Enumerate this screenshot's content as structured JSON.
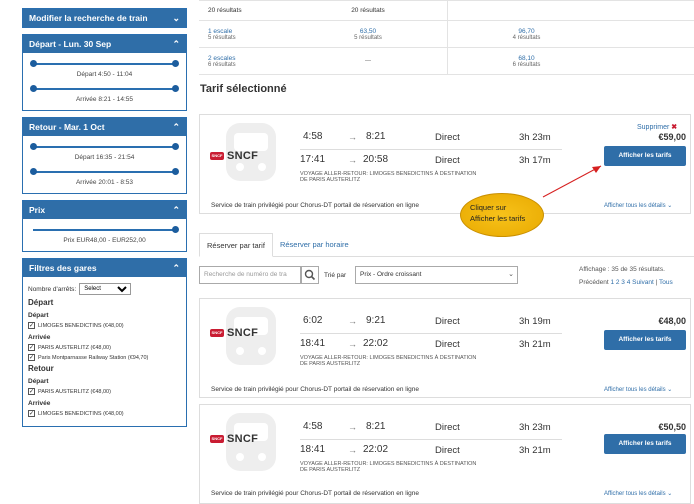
{
  "sidebar": {
    "modify_label": "Modifier la recherche de train",
    "depart_panel": {
      "title": "Départ - Lun. 30 Sep",
      "depart_range": "Départ   4:50 - 11:04",
      "arrivee_range": "Arrivée   8:21 - 14:55"
    },
    "retour_panel": {
      "title": "Retour - Mar. 1 Oct",
      "depart_range": "Départ   16:35 - 21:54",
      "arrivee_range": "Arrivée   20:01 - 8:53"
    },
    "prix_panel": {
      "title": "Prix",
      "range": "Prix   EUR48,00 - EUR252,00"
    },
    "gares_panel": {
      "title": "Filtres des gares",
      "nombre_label": "Nombre d'arrêts:",
      "nombre_value": "Select",
      "depart_heading": "Départ",
      "depart_sub": "Départ",
      "depart_station": "LIMOGES BENEDICTINS (€48,00)",
      "arrivee_sub": "Arrivée",
      "arrivee_station1": "PARIS AUSTERLITZ (€48,00)",
      "arrivee_station2": "Paris Montparnasse Railway Station (€94,70)",
      "retour_heading": "Retour",
      "retour_depart_sub": "Départ",
      "retour_depart_station": "PARIS AUSTERLITZ (€48,00)",
      "retour_arrivee_sub": "Arrivée",
      "retour_arrivee_station": "LIMOGES BENEDICTINS (€48,00)"
    }
  },
  "summary_table": {
    "rows": [
      {
        "label": "20 résultats",
        "col2": "20 résultats",
        "col3_main": "",
        "col3_sub": ""
      },
      {
        "label": "1 escale",
        "label_sub": "5 résultats",
        "col2": "63,50",
        "col2_sub": "5 résultats",
        "col3_main": "96,70",
        "col3_sub": "4 résultats"
      },
      {
        "label": "2 escales",
        "label_sub": "6 résultats",
        "col2": "—",
        "col2_sub": "",
        "col3_main": "68,10",
        "col3_sub": "6 résultats"
      }
    ]
  },
  "selected": {
    "heading": "Tarif sélectionné",
    "remove_label": "Supprimer",
    "remove_x": "✖",
    "price": "€59,00",
    "button": "Afficher les tarifs",
    "leg1": {
      "dep": "4:58",
      "arr": "8:21",
      "type": "Direct",
      "duration": "3h 23m"
    },
    "leg2": {
      "dep": "17:41",
      "arr": "20:58",
      "type": "Direct",
      "duration": "3h 17m"
    },
    "voyage": "VOYAGE ALLER-RETOUR: LIMOGES BENEDICTINS À DESTINATION DE PARIS AUSTERLITZ",
    "service": "Service de train privilégié pour Chorus-DT portail de réservation en ligne",
    "details": "Afficher tous les détails ⌄",
    "carrier": "SNCF"
  },
  "callout": {
    "line1": "Cliquer sur",
    "line2": "Afficher les tarifs"
  },
  "tabs": {
    "by_fare": "Réserver par tarif",
    "by_time": "Réserver par horaire"
  },
  "filter": {
    "search_placeholder": "Recherche de numéro de tra",
    "sort_label": "Trié par",
    "sort_value": "Prix - Ordre croissant",
    "affichage": "Affichage : 35 de 35 résultats.",
    "pager_prev": "Précédent",
    "pager_pages": "1 2 3 4",
    "pager_next": "Suivant",
    "pager_all": "Tous"
  },
  "results": [
    {
      "price": "€48,00",
      "button": "Afficher les tarifs",
      "carrier": "SNCF",
      "leg1": {
        "dep": "6:02",
        "arr": "9:21",
        "type": "Direct",
        "duration": "3h 19m"
      },
      "leg2": {
        "dep": "18:41",
        "arr": "22:02",
        "type": "Direct",
        "duration": "3h 21m"
      },
      "voyage": "VOYAGE ALLER-RETOUR: LIMOGES BENEDICTINS À DESTINATION DE PARIS AUSTERLITZ",
      "service": "Service de train privilégié pour Chorus-DT portail de réservation en ligne",
      "details": "Afficher tous les détails ⌄"
    },
    {
      "price": "€50,50",
      "button": "Afficher les tarifs",
      "carrier": "SNCF",
      "leg1": {
        "dep": "4:58",
        "arr": "8:21",
        "type": "Direct",
        "duration": "3h 23m"
      },
      "leg2": {
        "dep": "18:41",
        "arr": "22:02",
        "type": "Direct",
        "duration": "3h 21m"
      },
      "voyage": "VOYAGE ALLER-RETOUR: LIMOGES BENEDICTINS À DESTINATION DE PARIS AUSTERLITZ",
      "service": "Service de train privilégié pour Chorus-DT portail de réservation en ligne",
      "details": "Afficher tous les détails ⌄"
    }
  ],
  "icons": {
    "arrow": "→",
    "chevron_down": "⌄",
    "chevron_up": "⌃",
    "search": "magnifier"
  },
  "colors": {
    "primary": "#2f6ea8",
    "callout": "#f7c21a",
    "sncf_red": "#c91c32"
  }
}
